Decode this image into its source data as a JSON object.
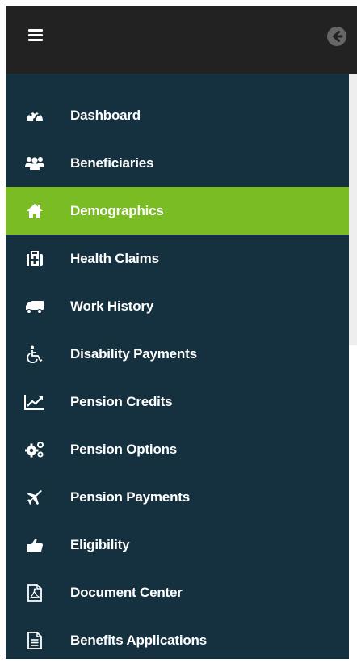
{
  "colors": {
    "topbar": "#222222",
    "sidebar": "#15303f",
    "active": "#79bc24",
    "text": "#ffffff"
  },
  "topbar": {
    "menu_icon": "hamburger-menu-icon",
    "back_icon": "arrow-left-circle-icon"
  },
  "nav": {
    "active_index": 2,
    "items": [
      {
        "label": "Dashboard",
        "icon": "dashboard-gauge-icon"
      },
      {
        "label": "Beneficiaries",
        "icon": "users-group-icon"
      },
      {
        "label": "Demographics",
        "icon": "home-icon"
      },
      {
        "label": "Health Claims",
        "icon": "medical-kit-icon"
      },
      {
        "label": "Work History",
        "icon": "truck-icon"
      },
      {
        "label": "Disability Payments",
        "icon": "wheelchair-icon"
      },
      {
        "label": "Pension Credits",
        "icon": "line-chart-icon"
      },
      {
        "label": "Pension Options",
        "icon": "gears-icon"
      },
      {
        "label": "Pension Payments",
        "icon": "plane-icon"
      },
      {
        "label": "Eligibility",
        "icon": "thumbs-up-icon"
      },
      {
        "label": "Document Center",
        "icon": "pdf-file-icon"
      },
      {
        "label": "Benefits Applications",
        "icon": "text-file-icon"
      }
    ]
  }
}
